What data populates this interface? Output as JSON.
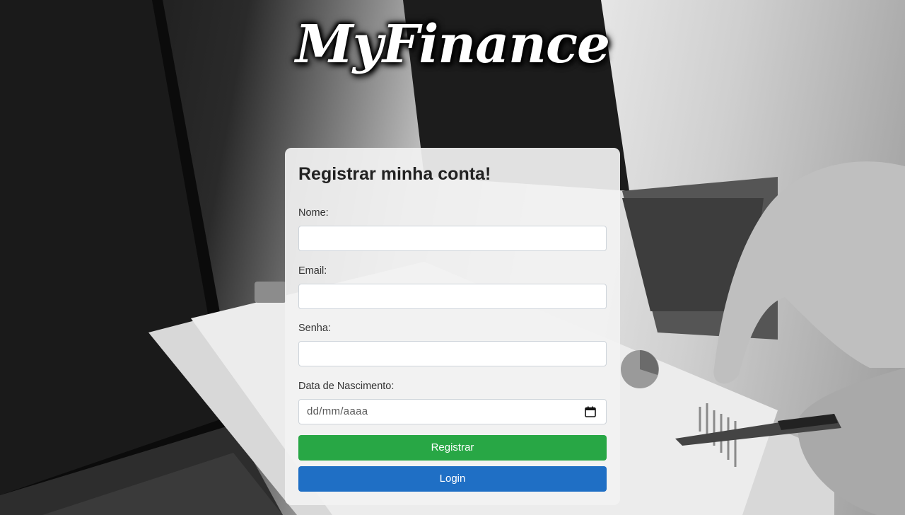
{
  "app": {
    "logo_text": "MyFinance"
  },
  "form": {
    "title": "Registrar minha conta!",
    "fields": [
      {
        "label": "Nome:",
        "value": "",
        "placeholder": ""
      },
      {
        "label": "Email:",
        "value": "",
        "placeholder": ""
      },
      {
        "label": "Senha:",
        "value": "",
        "placeholder": ""
      },
      {
        "label": "Data de Nascimento:",
        "value": "",
        "placeholder": "dd/mm/aaaa"
      }
    ],
    "register_label": "Registrar",
    "login_label": "Login"
  },
  "colors": {
    "register_button": "#28a745",
    "login_button": "#1f6fc5",
    "card_background": "#f2f2f2"
  },
  "icons": {
    "date_picker": "calendar-icon"
  }
}
